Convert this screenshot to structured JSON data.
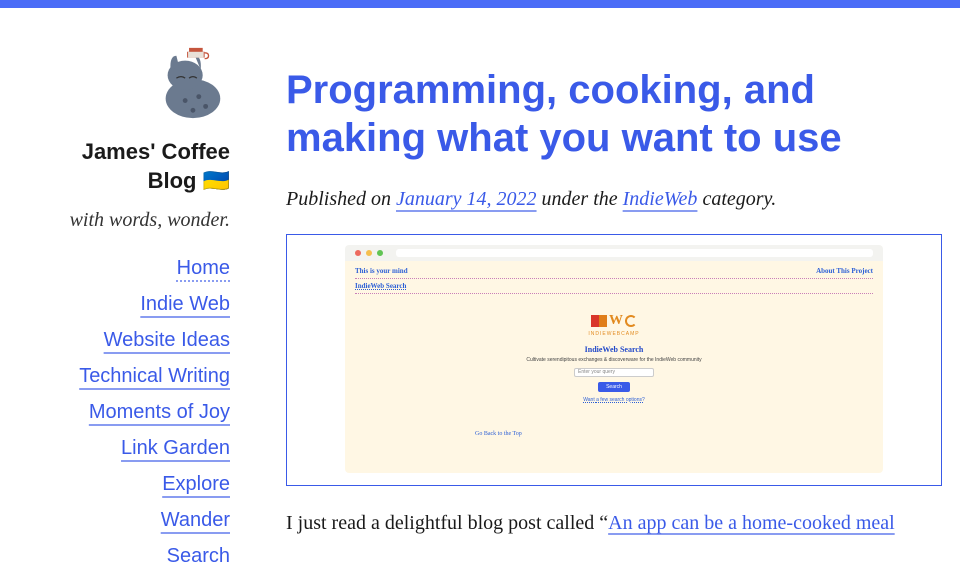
{
  "site": {
    "title_line1": "James' Coffee",
    "title_line2": "Blog",
    "flag": "🇺🇦",
    "tagline": "with words, wonder."
  },
  "nav": {
    "items": [
      "Home",
      "Indie Web",
      "Website Ideas",
      "Technical Writing",
      "Moments of Joy",
      "Link Garden",
      "Explore",
      "Wander",
      "Search"
    ]
  },
  "post": {
    "title": "Programming, cooking, and making what you want to use",
    "meta_prefix": "Published on ",
    "date": "January 14, 2022",
    "meta_mid": " under the ",
    "category": "IndieWeb",
    "meta_suffix": " category."
  },
  "screenshot": {
    "top_left": "This is your mind",
    "top_right": "About This Project",
    "sub_left": "IndieWeb Search",
    "center_title": "IndieWeb Search",
    "center_desc": "Cultivate serendipitous exchanges & discoverware for the IndieWeb community",
    "input_placeholder": "Enter your query",
    "button": "Search",
    "want_prefix": "Want ",
    "want_link": "a few search options?",
    "sub_bottom": "Go Back to the Top",
    "iwc_camp": "INDIEWEBCAMP"
  },
  "body": {
    "text_before_link": "I just read a delightful blog post called “",
    "link_text": "An app can be a home-cooked meal"
  }
}
